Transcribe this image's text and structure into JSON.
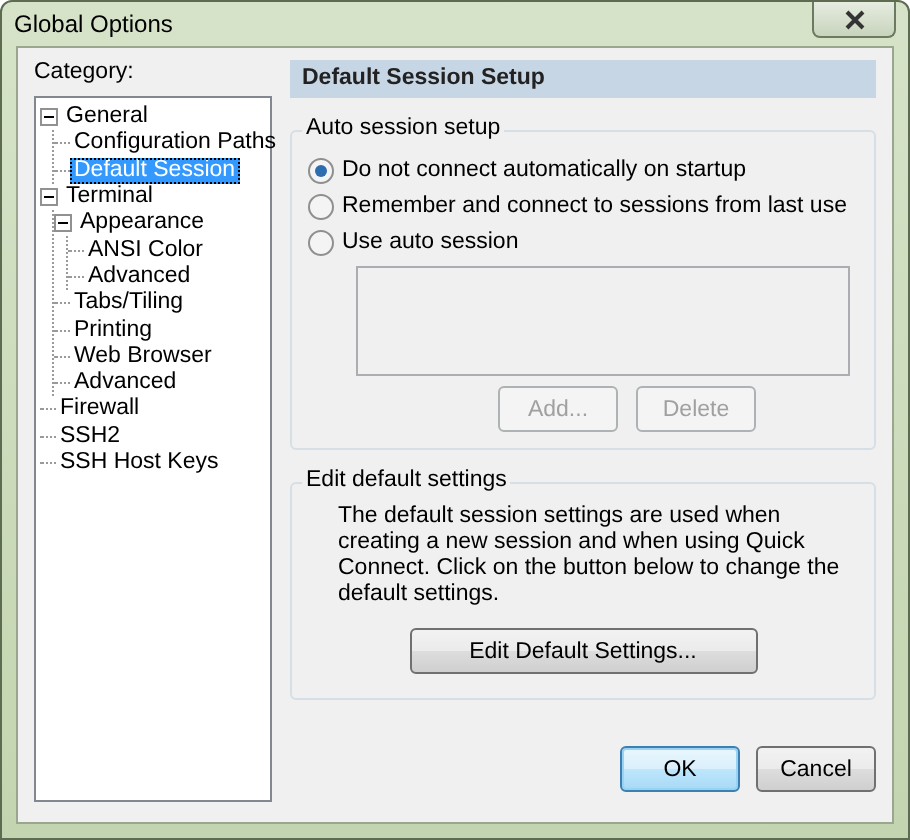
{
  "window": {
    "title": "Global Options"
  },
  "category_label": "Category:",
  "tree": [
    {
      "label": "General",
      "expanded": true,
      "selected": false,
      "children": [
        {
          "label": "Configuration Paths",
          "selected": false
        },
        {
          "label": "Default Session",
          "selected": true
        }
      ]
    },
    {
      "label": "Terminal",
      "expanded": true,
      "selected": false,
      "children": [
        {
          "label": "Appearance",
          "expanded": true,
          "selected": false,
          "children": [
            {
              "label": "ANSI Color",
              "selected": false
            },
            {
              "label": "Advanced",
              "selected": false
            }
          ]
        },
        {
          "label": "Tabs/Tiling",
          "selected": false
        },
        {
          "label": "Printing",
          "selected": false
        },
        {
          "label": "Web Browser",
          "selected": false
        },
        {
          "label": "Advanced",
          "selected": false
        }
      ]
    },
    {
      "label": "Firewall",
      "selected": false
    },
    {
      "label": "SSH2",
      "selected": false
    },
    {
      "label": "SSH Host Keys",
      "selected": false
    }
  ],
  "panel": {
    "header": "Default Session Setup",
    "auto_session": {
      "title": "Auto session setup",
      "options": [
        {
          "label": "Do not connect automatically on startup",
          "selected": true
        },
        {
          "label": "Remember and connect to sessions from last use",
          "selected": false
        },
        {
          "label": "Use auto session",
          "selected": false
        }
      ],
      "buttons": [
        {
          "label": "Add...",
          "disabled": true
        },
        {
          "label": "Delete",
          "disabled": true
        }
      ]
    },
    "edit_defaults": {
      "title": "Edit default settings",
      "description": "The default session settings are used when creating a new session and when using Quick Connect.  Click on the button below to change the default settings.",
      "button": "Edit Default Settings..."
    }
  },
  "buttons": [
    {
      "label": "OK",
      "default": true
    },
    {
      "label": "Cancel",
      "default": false
    }
  ]
}
